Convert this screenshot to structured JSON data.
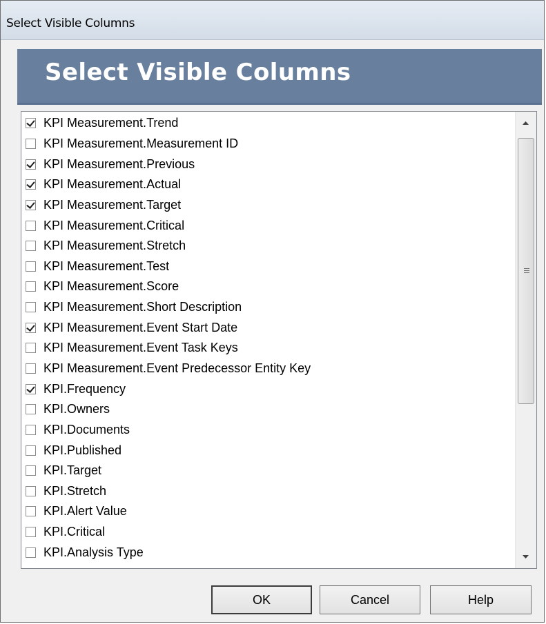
{
  "window": {
    "title": "Select Visible Columns"
  },
  "header": {
    "title": "Select Visible Columns"
  },
  "columns": [
    {
      "label": "KPI Measurement.Trend",
      "checked": true
    },
    {
      "label": "KPI Measurement.Measurement ID",
      "checked": false
    },
    {
      "label": "KPI Measurement.Previous",
      "checked": true
    },
    {
      "label": "KPI Measurement.Actual",
      "checked": true
    },
    {
      "label": "KPI Measurement.Target",
      "checked": true
    },
    {
      "label": "KPI Measurement.Critical",
      "checked": false
    },
    {
      "label": "KPI Measurement.Stretch",
      "checked": false
    },
    {
      "label": "KPI Measurement.Test",
      "checked": false
    },
    {
      "label": "KPI Measurement.Score",
      "checked": false
    },
    {
      "label": "KPI Measurement.Short Description",
      "checked": false
    },
    {
      "label": "KPI Measurement.Event Start Date",
      "checked": true
    },
    {
      "label": "KPI Measurement.Event Task Keys",
      "checked": false
    },
    {
      "label": "KPI Measurement.Event Predecessor Entity Key",
      "checked": false
    },
    {
      "label": "KPI.Frequency",
      "checked": true
    },
    {
      "label": "KPI.Owners",
      "checked": false
    },
    {
      "label": "KPI.Documents",
      "checked": false
    },
    {
      "label": "KPI.Published",
      "checked": false
    },
    {
      "label": "KPI.Target",
      "checked": false
    },
    {
      "label": "KPI.Stretch",
      "checked": false
    },
    {
      "label": "KPI.Alert Value",
      "checked": false
    },
    {
      "label": "KPI.Critical",
      "checked": false
    },
    {
      "label": "KPI.Analysis Type",
      "checked": false
    }
  ],
  "buttons": {
    "ok": "OK",
    "cancel": "Cancel",
    "help": "Help"
  },
  "icons": {
    "scroll_up": "scroll-up-arrow-icon",
    "scroll_down": "scroll-down-arrow-icon",
    "grip": "scroll-thumb-grip-icon",
    "checkmark": "checkmark-icon"
  },
  "colors": {
    "header_bg": "#687f9d",
    "header_text": "#ffffff",
    "dialog_bg": "#f0f0f0"
  }
}
